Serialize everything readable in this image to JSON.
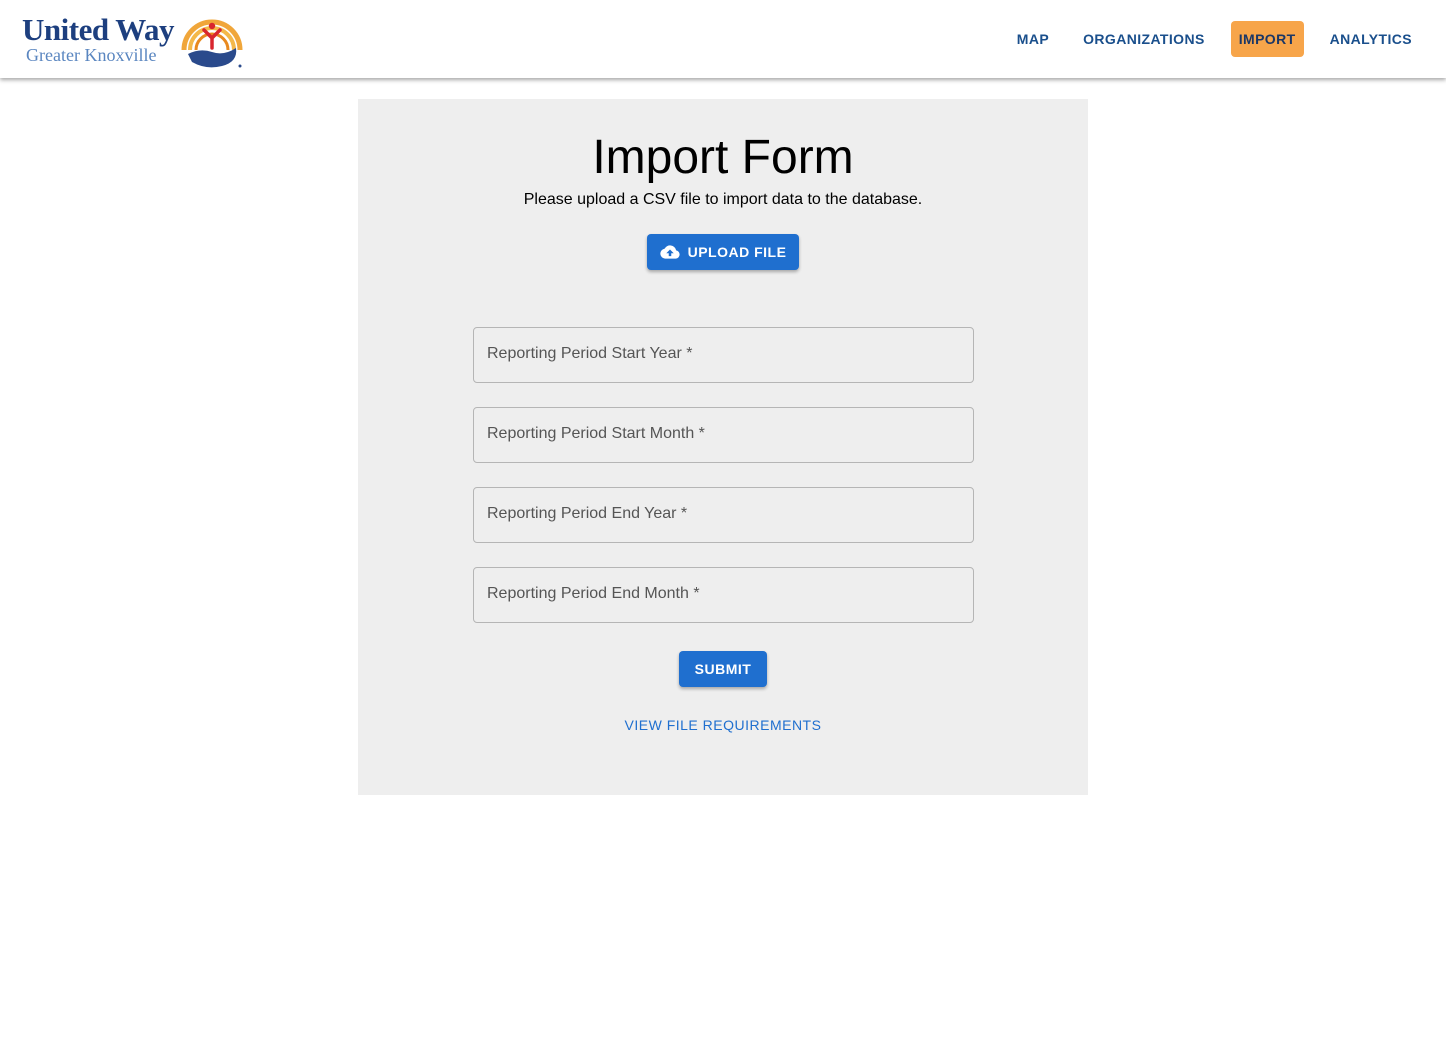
{
  "header": {
    "logo": {
      "line1": "United Way",
      "line2": "Greater Knoxville"
    },
    "nav": [
      {
        "label": "MAP",
        "active": false
      },
      {
        "label": "ORGANIZATIONS",
        "active": false
      },
      {
        "label": "IMPORT",
        "active": true
      },
      {
        "label": "ANALYTICS",
        "active": false
      }
    ]
  },
  "form": {
    "title": "Import Form",
    "subtitle": "Please upload a CSV file to import data to the database.",
    "upload_label": "UPLOAD FILE",
    "upload_icon": "cloud-upload-icon",
    "fields": [
      {
        "label": "Reporting Period Start Year *",
        "value": ""
      },
      {
        "label": "Reporting Period Start Month *",
        "value": ""
      },
      {
        "label": "Reporting Period End Year *",
        "value": ""
      },
      {
        "label": "Reporting Period End Month *",
        "value": ""
      }
    ],
    "submit_label": "SUBMIT",
    "requirements_link": "VIEW FILE REQUIREMENTS"
  },
  "colors": {
    "primary": "#1f6fcf",
    "nav_text": "#1a4f8c",
    "nav_active_bg": "#f7a54a",
    "panel_bg": "#eeeeee",
    "logo_blue": "#1d3f7f"
  }
}
